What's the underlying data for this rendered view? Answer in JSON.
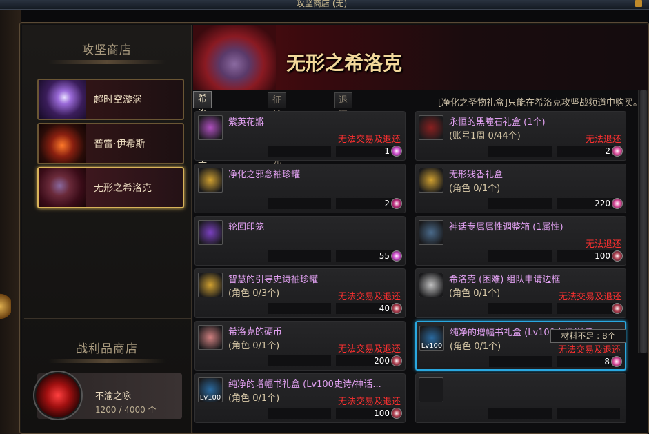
{
  "window": {
    "title": "攻坚商店 (无)"
  },
  "left": {
    "section_title": "攻坚商店",
    "npcs": [
      {
        "label": "超时空漩涡"
      },
      {
        "label": "普雷·伊希斯"
      },
      {
        "label": "无形之希洛克"
      }
    ],
    "loot_title": "战利品商店",
    "loot": {
      "name": "不渝之咏",
      "count": "1200 / 4000 个"
    }
  },
  "right": {
    "banner_title": "无形之希洛克",
    "tabs": [
      {
        "label": "希洛克攻坚战",
        "active": true
      },
      {
        "label": "征战希洛克",
        "active": false
      },
      {
        "label": "退还",
        "active": false
      }
    ],
    "notice": "[净化之圣物礼盒]只能在希洛克攻坚战频道中购买。",
    "tooltip": "材料不足 : 8个",
    "items": [
      {
        "name": "紫英花瓣",
        "limit": "",
        "warn": "无法交易及退还",
        "price": "1",
        "icon": "purple-petal-icon",
        "icon_text": "",
        "icon_color": "#b050c0",
        "cur_color": "#d050d0"
      },
      {
        "name": "永恒的黑瞳石礼盒 (1个)",
        "limit": "(账号1周 0/44个)",
        "warn": "无法退还",
        "price": "2",
        "icon": "black-gem-box-icon",
        "icon_text": "",
        "icon_color": "#8a2020",
        "cur_color": "#e050a0"
      },
      {
        "name": "净化之邪念袖珍罐",
        "limit": "",
        "warn": "",
        "price": "2",
        "icon": "purify-jar-icon",
        "icon_text": "",
        "icon_color": "#d0a030",
        "cur_color": "#c03080"
      },
      {
        "name": "无形残香礼盒",
        "limit": "(角色 0/1个)",
        "warn": "",
        "price": "220",
        "icon": "gift-box-icon",
        "icon_text": "",
        "icon_color": "#d0a030",
        "cur_color": "#e050a0"
      },
      {
        "name": "轮回印笼",
        "limit": "",
        "warn": "",
        "price": "55",
        "icon": "reincarnation-seal-icon",
        "icon_text": "",
        "icon_color": "#7a40c0",
        "cur_color": "#d050d0"
      },
      {
        "name": "神话专属属性调整箱 (1属性)",
        "limit": "",
        "warn": "无法退还",
        "price": "100",
        "icon": "mythic-box-icon",
        "icon_text": "",
        "icon_color": "#4a6a8a",
        "cur_color": "#b04050"
      },
      {
        "name": "智慧的引导史诗袖珍罐",
        "limit": "(角色 0/3个)",
        "warn": "无法交易及退还",
        "price": "40",
        "icon": "epic-jar-icon",
        "icon_text": "",
        "icon_color": "#d0a030",
        "cur_color": "#b04050"
      },
      {
        "name": "希洛克 (困难) 组队申请边框",
        "limit": "(角色 0/1个)",
        "warn": "无法交易及退还",
        "price": "",
        "icon": "frame-card-icon",
        "icon_text": "",
        "icon_color": "#c0c0c0",
        "cur_color": "#b04050"
      },
      {
        "name": "希洛克的硬币",
        "limit": "(角色 0/1个)",
        "warn": "无法交易及退还",
        "price": "200",
        "icon": "coin-icon",
        "icon_text": "",
        "icon_color": "#d08080",
        "cur_color": "#b04050"
      },
      {
        "name": "纯净的增幅书礼盒 (Lv100史诗/神话...",
        "limit": "(角色 0/1个)",
        "warn": "无法交易及退还",
        "price": "8",
        "icon": "amplify-book-box-icon",
        "icon_text": "Lv100",
        "icon_color": "#2a6aa0",
        "cur_color": "#e050a0"
      },
      {
        "name": "纯净的增幅书礼盒 (Lv100史诗/神话...",
        "limit": "(角色 0/1个)",
        "warn": "无法交易及退还",
        "price": "100",
        "icon": "amplify-book-box-icon",
        "icon_text": "Lv100",
        "icon_color": "#2a6aa0",
        "cur_color": "#b04050"
      },
      {
        "name": "",
        "limit": "",
        "warn": "",
        "price": "",
        "icon": "empty-slot-icon",
        "icon_text": "",
        "icon_color": "#1a1a1c",
        "cur_color": ""
      }
    ]
  }
}
